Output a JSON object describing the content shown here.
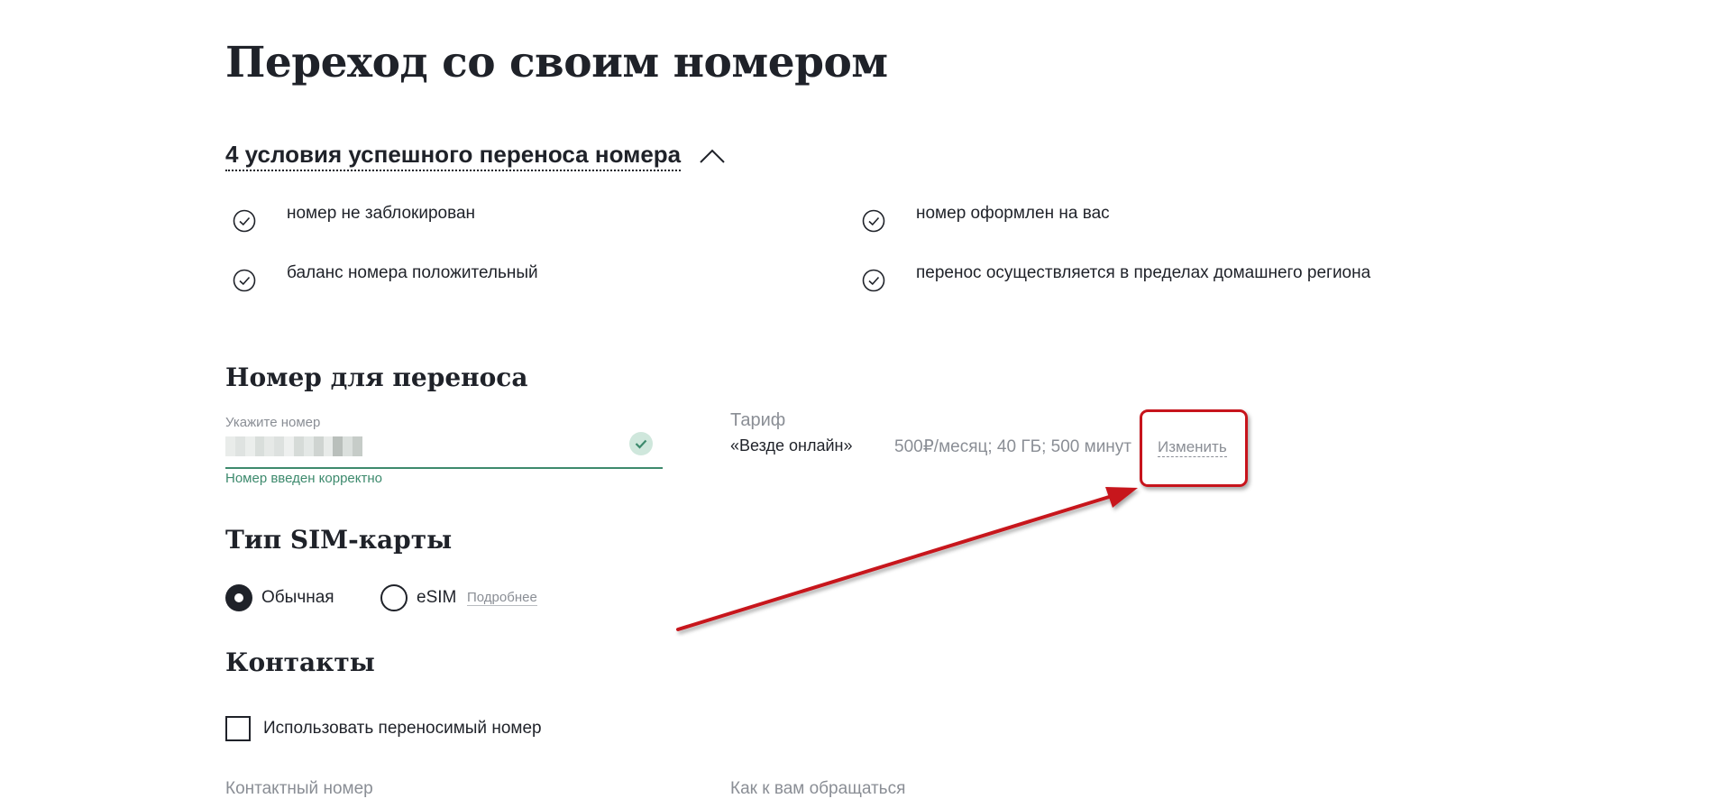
{
  "page": {
    "title": "Переход со своим номером"
  },
  "conditions": {
    "title": "4 условия успешного переноса номера",
    "items": [
      "номер не заблокирован",
      "номер оформлен на вас",
      "баланс номера положительный",
      "перенос осуществляется в пределах домашнего региона"
    ]
  },
  "number_section": {
    "title": "Номер для переноса",
    "field_label": "Укажите номер",
    "validation_message": "Номер введен корректно"
  },
  "tariff": {
    "label": "Тариф",
    "name": "«Везде онлайн»",
    "description": "500₽/месяц; 40 ГБ; 500 минут",
    "change_label": "Изменить"
  },
  "sim_section": {
    "title": "Тип SIM-карты",
    "options": [
      {
        "label": "Обычная",
        "selected": true
      },
      {
        "label": "eSIM",
        "selected": false
      }
    ],
    "more_link": "Подробнее"
  },
  "contacts": {
    "title": "Контакты",
    "checkbox_label": "Использовать переносимый номер",
    "contact_number_label": "Контактный номер",
    "address_label": "Как к вам обращаться"
  },
  "colors": {
    "accent_green": "#3d8a6d",
    "highlight_red": "#c7141c",
    "text_dark": "#1f2229",
    "text_muted": "#8a8e95"
  }
}
